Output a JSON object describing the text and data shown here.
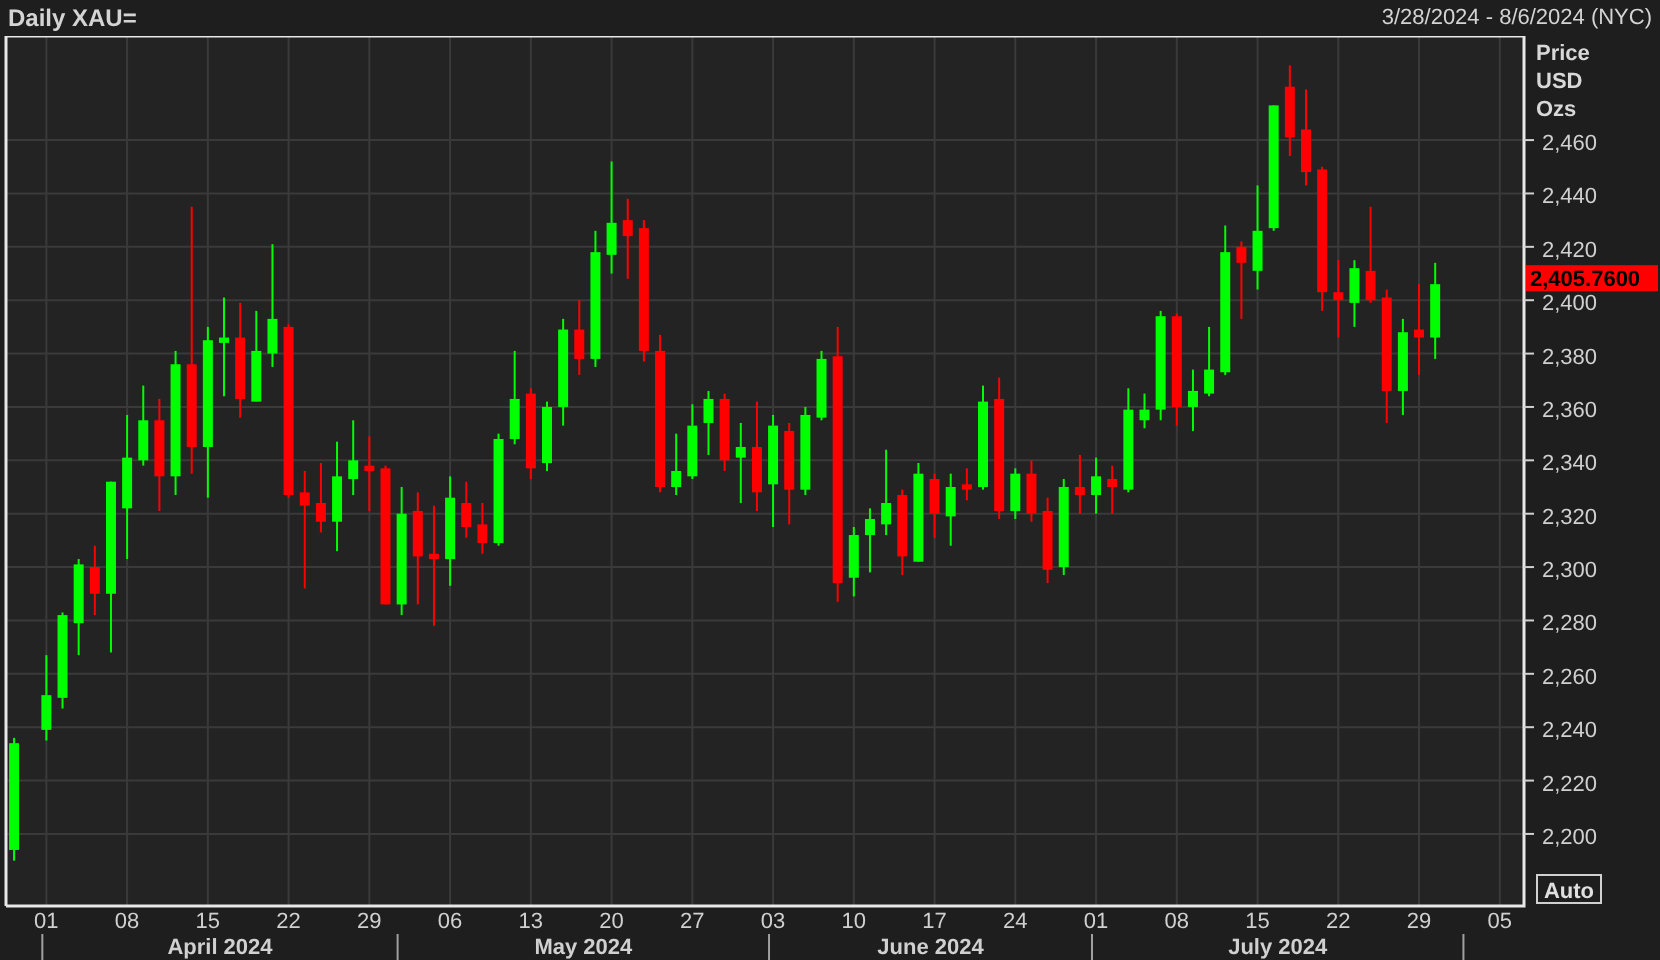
{
  "header": {
    "title": "Daily XAU=",
    "date_range": "3/28/2024 - 8/6/2024 (NYC)"
  },
  "chart": {
    "axis_titles": [
      "Price",
      "USD",
      "Ozs"
    ],
    "auto_button": "Auto",
    "last_price": "2,405.7600",
    "month_labels": [
      "April 2024",
      "May 2024",
      "June 2024",
      "July 2024"
    ],
    "chart_data": {
      "type": "candlestick",
      "grid": true,
      "categories": [
        null,
        null,
        "01",
        null,
        null,
        null,
        null,
        "08",
        null,
        null,
        null,
        null,
        "15",
        null,
        null,
        null,
        null,
        "22",
        null,
        null,
        null,
        null,
        "29",
        null,
        null,
        null,
        null,
        "06",
        null,
        null,
        null,
        null,
        "13",
        null,
        null,
        null,
        null,
        "20",
        null,
        null,
        null,
        null,
        "27",
        null,
        null,
        null,
        null,
        "03",
        null,
        null,
        null,
        null,
        "10",
        null,
        null,
        null,
        null,
        "17",
        null,
        null,
        null,
        null,
        "24",
        null,
        null,
        null,
        null,
        "01",
        null,
        null,
        null,
        null,
        "08",
        null,
        null,
        null,
        null,
        "15",
        null,
        null,
        null,
        null,
        "22",
        null,
        null,
        null,
        null,
        "29",
        null,
        null,
        null,
        null,
        "05",
        null
      ],
      "ohlc": [
        [
          2194,
          2236,
          2190,
          2234
        ],
        null,
        [
          2239,
          2267,
          2235,
          2252
        ],
        [
          2251,
          2283,
          2247,
          2282
        ],
        [
          2279,
          2303,
          2267,
          2301
        ],
        [
          2300,
          2308,
          2282,
          2290
        ],
        [
          2290,
          2332,
          2268,
          2332
        ],
        [
          2322,
          2357,
          2303,
          2341
        ],
        [
          2340,
          2368,
          2338,
          2355
        ],
        [
          2355,
          2363,
          2321,
          2334
        ],
        [
          2334,
          2381,
          2327,
          2376
        ],
        [
          2376,
          2435,
          2335,
          2345
        ],
        [
          2345,
          2390,
          2326,
          2385
        ],
        [
          2384,
          2401,
          2364,
          2386
        ],
        [
          2386,
          2399,
          2356,
          2363
        ],
        [
          2362,
          2396,
          2362,
          2381
        ],
        [
          2380,
          2421,
          2375,
          2393
        ],
        [
          2390,
          2391,
          2326,
          2327
        ],
        [
          2328,
          2336,
          2292,
          2323
        ],
        [
          2324,
          2339,
          2313,
          2317
        ],
        [
          2317,
          2347,
          2306,
          2334
        ],
        [
          2333,
          2355,
          2327,
          2340
        ],
        [
          2338,
          2349,
          2321,
          2336
        ],
        [
          2337,
          2338,
          2286,
          2286
        ],
        [
          2286,
          2330,
          2282,
          2320
        ],
        [
          2321,
          2328,
          2286,
          2304
        ],
        [
          2305,
          2323,
          2278,
          2303
        ],
        [
          2303,
          2334,
          2293,
          2326
        ],
        [
          2324,
          2332,
          2311,
          2315
        ],
        [
          2316,
          2324,
          2305,
          2309
        ],
        [
          2309,
          2350,
          2308,
          2348
        ],
        [
          2348,
          2381,
          2346,
          2363
        ],
        [
          2365,
          2367,
          2333,
          2337
        ],
        [
          2339,
          2362,
          2336,
          2360
        ],
        [
          2360,
          2393,
          2353,
          2389
        ],
        [
          2389,
          2400,
          2372,
          2378
        ],
        [
          2378,
          2426,
          2375,
          2418
        ],
        [
          2417,
          2452,
          2410,
          2429
        ],
        [
          2430,
          2438,
          2408,
          2424
        ],
        [
          2427,
          2430,
          2377,
          2381
        ],
        [
          2381,
          2387,
          2328,
          2330
        ],
        [
          2330,
          2350,
          2327,
          2336
        ],
        [
          2334,
          2361,
          2333,
          2353
        ],
        [
          2354,
          2366,
          2342,
          2363
        ],
        [
          2363,
          2365,
          2336,
          2340
        ],
        [
          2341,
          2354,
          2324,
          2345
        ],
        [
          2345,
          2362,
          2321,
          2328
        ],
        [
          2331,
          2357,
          2315,
          2353
        ],
        [
          2351,
          2354,
          2316,
          2329
        ],
        [
          2329,
          2360,
          2327,
          2357
        ],
        [
          2356,
          2381,
          2355,
          2378
        ],
        [
          2379,
          2390,
          2287,
          2294
        ],
        [
          2296,
          2315,
          2289,
          2312
        ],
        [
          2312,
          2322,
          2298,
          2318
        ],
        [
          2316,
          2344,
          2312,
          2324
        ],
        [
          2327,
          2329,
          2297,
          2304
        ],
        [
          2302,
          2339,
          2302,
          2335
        ],
        [
          2333,
          2335,
          2311,
          2320
        ],
        [
          2319,
          2335,
          2308,
          2330
        ],
        [
          2331,
          2337,
          2325,
          2329
        ],
        [
          2330,
          2368,
          2329,
          2362
        ],
        [
          2363,
          2371,
          2318,
          2321
        ],
        [
          2321,
          2337,
          2318,
          2335
        ],
        [
          2335,
          2340,
          2317,
          2320
        ],
        [
          2321,
          2326,
          2294,
          2299
        ],
        [
          2300,
          2333,
          2297,
          2330
        ],
        [
          2330,
          2342,
          2320,
          2327
        ],
        [
          2327,
          2341,
          2320,
          2334
        ],
        [
          2333,
          2338,
          2320,
          2330
        ],
        [
          2329,
          2367,
          2328,
          2359
        ],
        [
          2355,
          2365,
          2352,
          2359
        ],
        [
          2359,
          2396,
          2355,
          2394
        ],
        [
          2394,
          2395,
          2353,
          2360
        ],
        [
          2360,
          2374,
          2351,
          2366
        ],
        [
          2365,
          2390,
          2364,
          2374
        ],
        [
          2373,
          2428,
          2372,
          2418
        ],
        [
          2420,
          2422,
          2393,
          2414
        ],
        [
          2411,
          2443,
          2404,
          2426
        ],
        [
          2427,
          2473,
          2426,
          2473
        ],
        [
          2480,
          2488,
          2454,
          2461
        ],
        [
          2464,
          2479,
          2443,
          2448
        ],
        [
          2449,
          2450,
          2396,
          2403
        ],
        [
          2403,
          2415,
          2386,
          2400
        ],
        [
          2399,
          2415,
          2390,
          2412
        ],
        [
          2411,
          2435,
          2399,
          2400
        ],
        [
          2401,
          2404,
          2354,
          2366
        ],
        [
          2366,
          2393,
          2357,
          2388
        ],
        [
          2389,
          2406,
          2372,
          2386
        ],
        [
          2386,
          2414,
          2378,
          2406
        ],
        null,
        null,
        null,
        null,
        null
      ],
      "ylim": [
        2173,
        2499
      ],
      "yticks": [
        {
          "value": 2200,
          "label": "2,200"
        },
        {
          "value": 2220,
          "label": "2,220"
        },
        {
          "value": 2240,
          "label": "2,240"
        },
        {
          "value": 2260,
          "label": "2,260"
        },
        {
          "value": 2280,
          "label": "2,280"
        },
        {
          "value": 2300,
          "label": "2,300"
        },
        {
          "value": 2320,
          "label": "2,320"
        },
        {
          "value": 2340,
          "label": "2,340"
        },
        {
          "value": 2360,
          "label": "2,360"
        },
        {
          "value": 2380,
          "label": "2,380"
        },
        {
          "value": 2400,
          "label": "2,400"
        },
        {
          "value": 2420,
          "label": "2,420"
        },
        {
          "value": 2440,
          "label": "2,440"
        },
        {
          "value": 2460,
          "label": "2,460"
        }
      ]
    }
  }
}
